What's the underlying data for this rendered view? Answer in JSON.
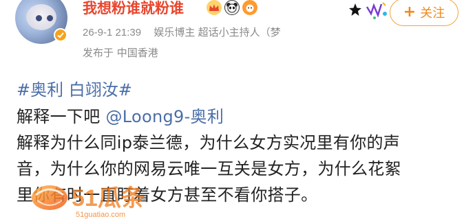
{
  "post": {
    "username": "我想粉谁就粉谁",
    "timestamp": "26-9-1 21:39",
    "source": "娱乐博主 超话小主持人（梦",
    "location": "发布于 中国香港",
    "follow_label": "关注",
    "topic": "#奥利 白翊汝#",
    "line1_prefix": "解释一下吧 ",
    "line1_mention": "@Loong9-奥利",
    "line2": "解释为什么同ip泰兰德，为什么女方实况里有你的声",
    "line3": "音，为什么你的网易云唯一互关是女方，为什么花絮",
    "line4": "里你有时一直盯着女方甚至不看你搭子。"
  },
  "watermark": {
    "brand": "51瓜条",
    "url": "51guatiao.com"
  },
  "colors": {
    "username": "#e8462d",
    "link": "#4a6ea8",
    "follow_border": "#f2a33a",
    "meta": "#8a8a8a",
    "watermark": "#f07a1a"
  }
}
